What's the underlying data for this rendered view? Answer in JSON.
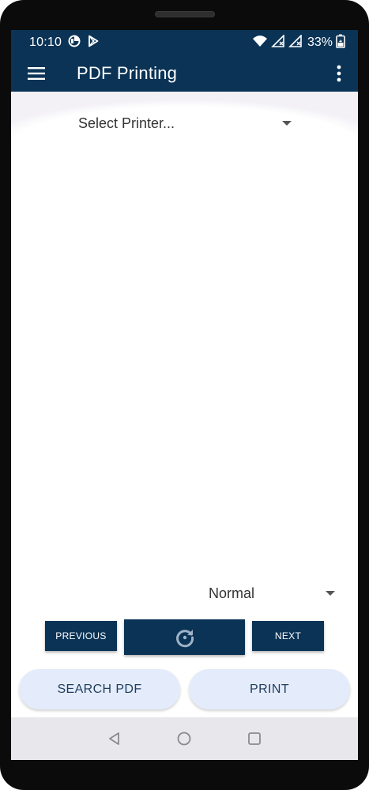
{
  "status_bar": {
    "time": "10:10",
    "battery_percent": "33%",
    "icons": [
      "data-saver-icon",
      "play-store-icon",
      "wifi-icon",
      "no-signal-icon",
      "no-signal-icon",
      "battery-charging-icon"
    ]
  },
  "app_bar": {
    "title": "PDF Printing",
    "menu_icon": "hamburger-menu-icon",
    "overflow_icon": "more-vertical-icon"
  },
  "printer_select": {
    "selected": "Select Printer..."
  },
  "scale_select": {
    "selected": "Normal"
  },
  "navigation": {
    "previous_label": "PREVIOUS",
    "rotate_icon": "rotate-icon",
    "next_label": "NEXT"
  },
  "actions": {
    "search_label": "SEARCH PDF",
    "print_label": "PRINT"
  },
  "colors": {
    "primary": "#0a3356",
    "action_button_bg": "#e4ecfb",
    "action_button_text": "#1f3d5c",
    "system_nav_bg": "#e8e7ec"
  }
}
